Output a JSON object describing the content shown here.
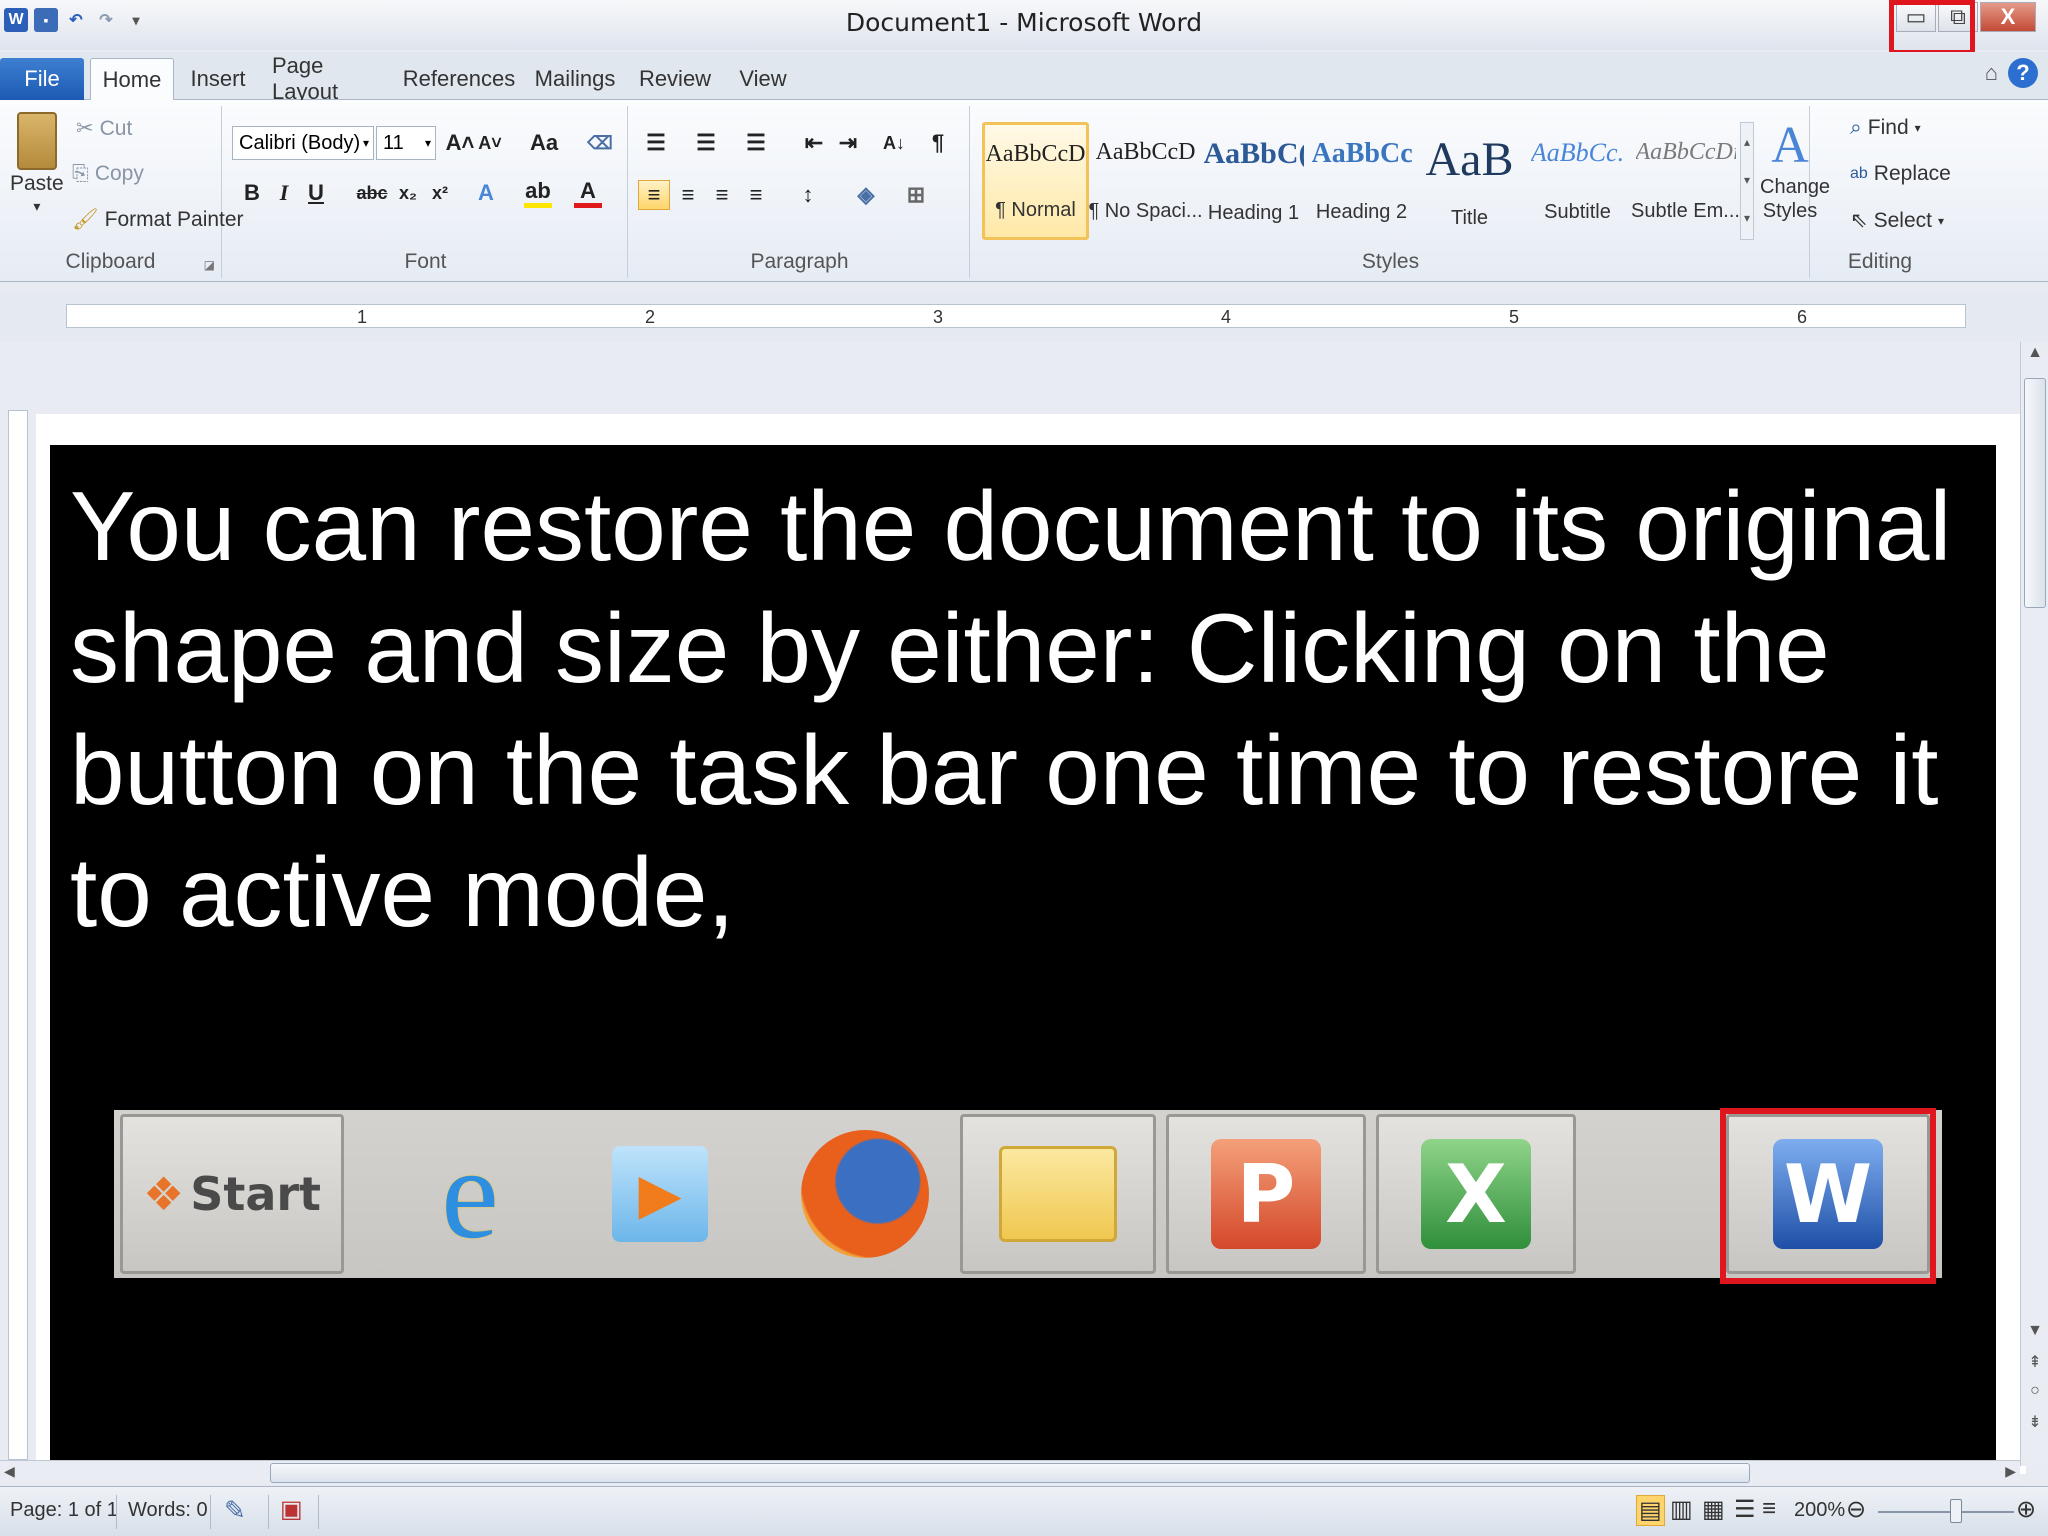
{
  "window": {
    "title": "Document1 - Microsoft Word",
    "app_icon": "W",
    "minimize_icon": "▭",
    "restore_icon": "⧉",
    "close_label": "X",
    "highlight_color": "#e0161f"
  },
  "tabs": [
    {
      "label": "File"
    },
    {
      "label": "Home"
    },
    {
      "label": "Insert"
    },
    {
      "label": "Page Layout"
    },
    {
      "label": "References"
    },
    {
      "label": "Mailings"
    },
    {
      "label": "Review"
    },
    {
      "label": "View"
    }
  ],
  "ribbon": {
    "clipboard": {
      "label": "Clipboard",
      "paste": "Paste",
      "cut": "Cut",
      "copy": "Copy",
      "format_painter": "Format Painter"
    },
    "font": {
      "label": "Font",
      "font_name": "Calibri (Body)",
      "font_size": "11",
      "change_case": "Aa"
    },
    "paragraph": {
      "label": "Paragraph"
    },
    "styles": {
      "label": "Styles",
      "items": [
        {
          "sample": "AaBbCcDc",
          "name": "¶ Normal"
        },
        {
          "sample": "AaBbCcDc",
          "name": "¶ No Spaci..."
        },
        {
          "sample": "AaBbC(",
          "name": "Heading 1"
        },
        {
          "sample": "AaBbCc",
          "name": "Heading 2"
        },
        {
          "sample": "AaB",
          "name": "Title"
        },
        {
          "sample": "AaBbCc.",
          "name": "Subtitle"
        },
        {
          "sample": "AaBbCcDi",
          "name": "Subtle Em..."
        }
      ],
      "change_styles": "Change Styles"
    },
    "editing": {
      "label": "Editing",
      "find": "Find",
      "replace": "Replace",
      "select": "Select"
    }
  },
  "ruler": {
    "numbers": [
      "1",
      "2",
      "3",
      "4",
      "5",
      "6"
    ]
  },
  "slide": {
    "text": "You can restore the document to its original shape and size by either: Clicking on the button on the task bar one time to restore it to active mode,",
    "taskbar": {
      "start_label": "Start",
      "apps": [
        {
          "name": "Internet Explorer",
          "glyph": "e"
        },
        {
          "name": "Windows Media Player",
          "glyph": "▶"
        },
        {
          "name": "Firefox",
          "glyph": ""
        },
        {
          "name": "Windows Explorer",
          "glyph": ""
        },
        {
          "name": "PowerPoint",
          "glyph": "P"
        },
        {
          "name": "Excel",
          "glyph": "X"
        },
        {
          "name": "Word",
          "glyph": "W"
        }
      ]
    }
  },
  "status": {
    "page": "Page: 1 of 1",
    "words": "Words: 0",
    "zoom": "200%"
  }
}
